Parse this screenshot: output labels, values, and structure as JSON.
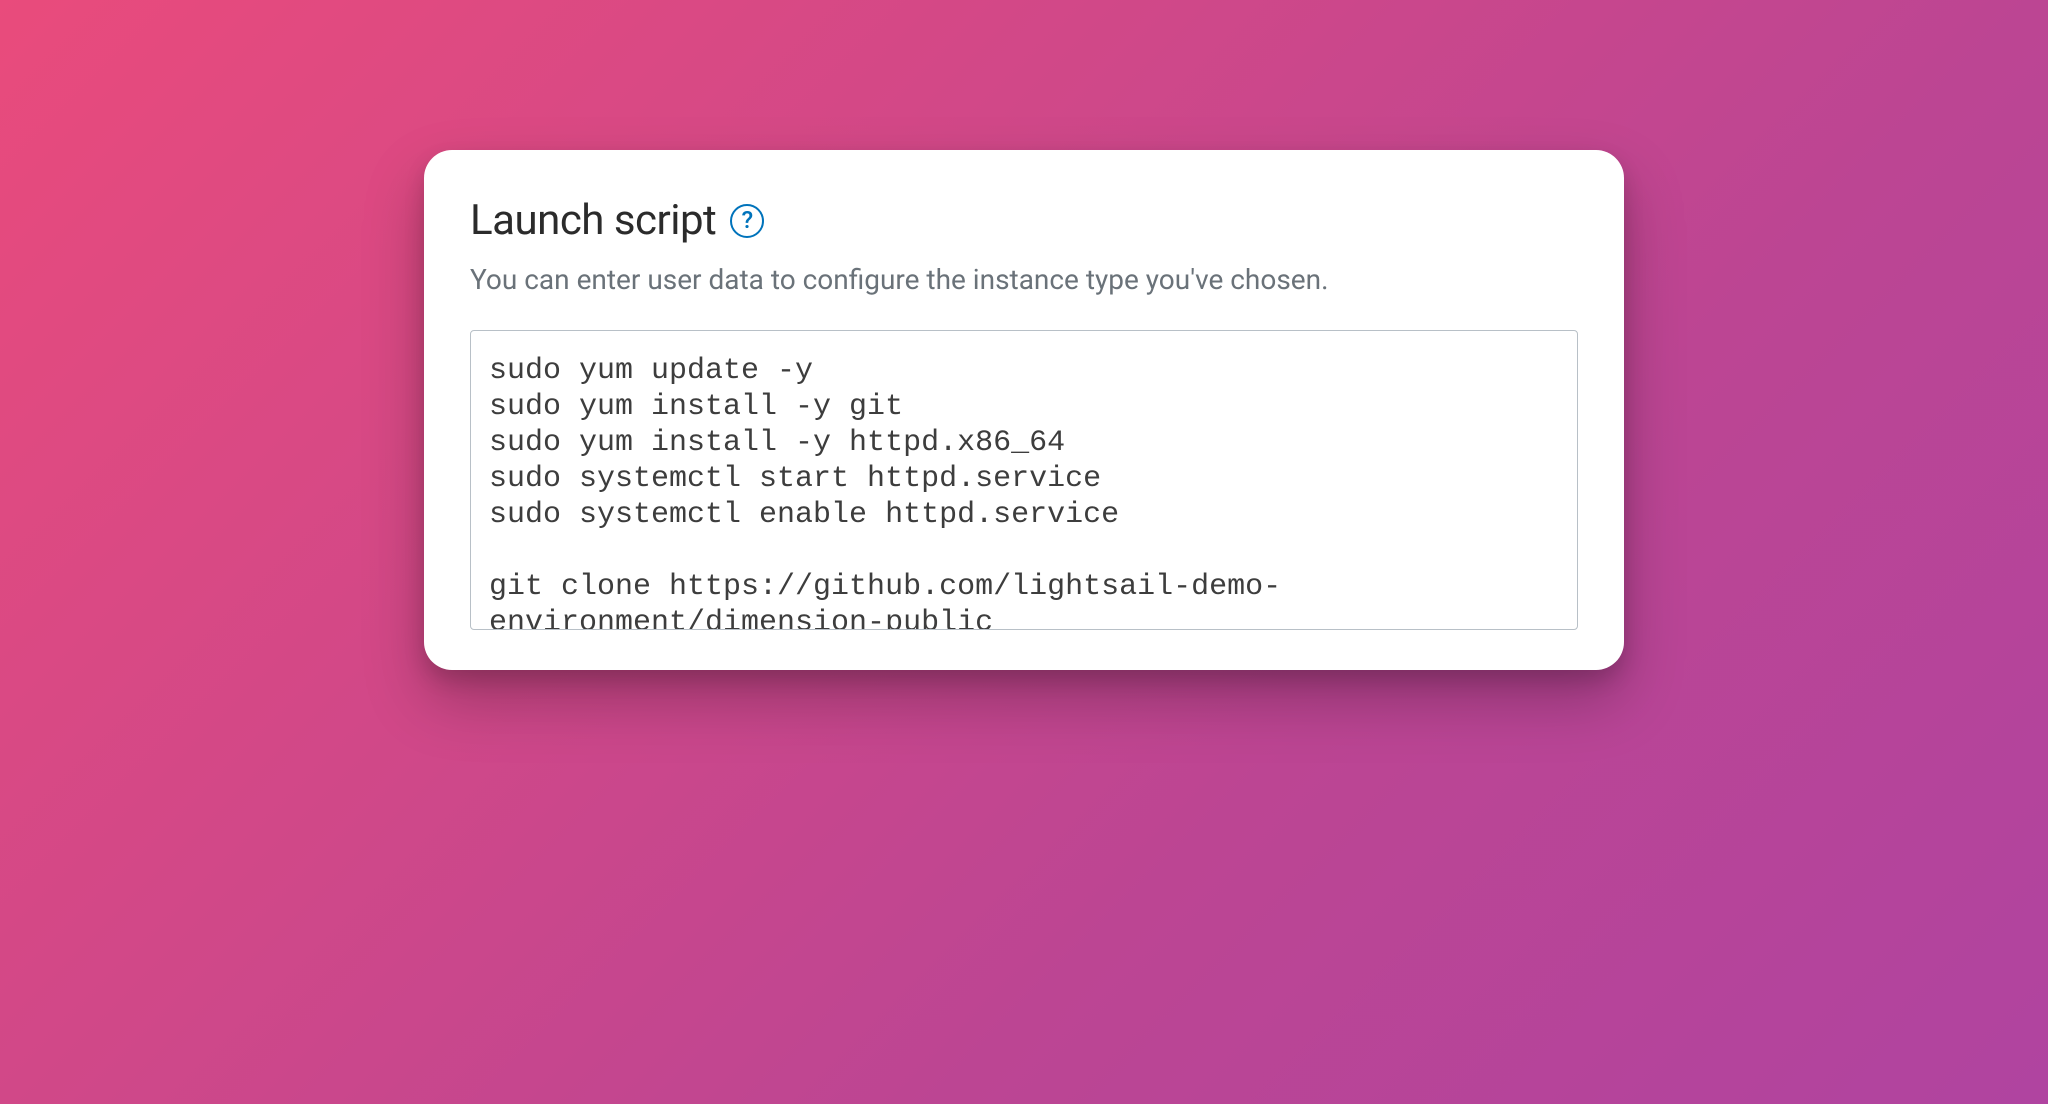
{
  "card": {
    "title": "Launch script",
    "help_glyph": "?",
    "description": "You can enter user data to configure the instance type you've chosen.",
    "script_value": "sudo yum update -y\nsudo yum install -y git\nsudo yum install -y httpd.x86_64\nsudo systemctl start httpd.service\nsudo systemctl enable httpd.service\n\ngit clone https://github.com/lightsail-demo-environment/dimension-public"
  }
}
